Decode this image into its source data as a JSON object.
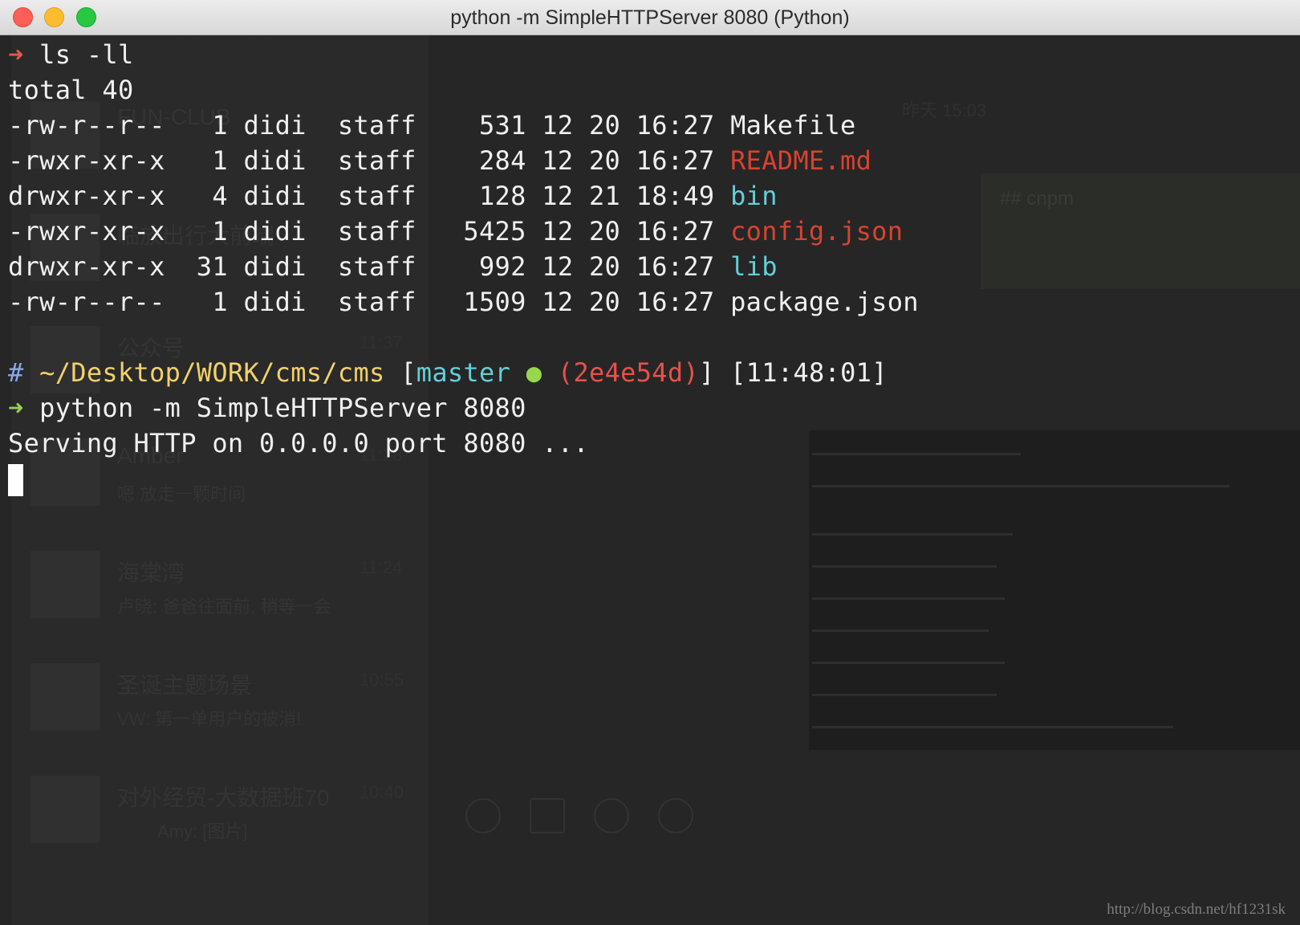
{
  "window": {
    "title": "python -m SimpleHTTPServer 8080 (Python)"
  },
  "terminal": {
    "prompt_arrow": "➜",
    "cmd1": "ls -ll",
    "total": "total 40",
    "files": [
      {
        "perms": "-rw-r--r--",
        "links": "1",
        "owner": "didi",
        "group": "staff",
        "size": "531",
        "month": "12",
        "day": "20",
        "time": "16:27",
        "name": "Makefile",
        "kind": "plain"
      },
      {
        "perms": "-rwxr-xr-x",
        "links": "1",
        "owner": "didi",
        "group": "staff",
        "size": "284",
        "month": "12",
        "day": "20",
        "time": "16:27",
        "name": "README.md",
        "kind": "exec"
      },
      {
        "perms": "drwxr-xr-x",
        "links": "4",
        "owner": "didi",
        "group": "staff",
        "size": "128",
        "month": "12",
        "day": "21",
        "time": "18:49",
        "name": "bin",
        "kind": "dir"
      },
      {
        "perms": "-rwxr-xr-x",
        "links": "1",
        "owner": "didi",
        "group": "staff",
        "size": "5425",
        "month": "12",
        "day": "20",
        "time": "16:27",
        "name": "config.json",
        "kind": "exec"
      },
      {
        "perms": "drwxr-xr-x",
        "links": "31",
        "owner": "didi",
        "group": "staff",
        "size": "992",
        "month": "12",
        "day": "20",
        "time": "16:27",
        "name": "lib",
        "kind": "dir"
      },
      {
        "perms": "-rw-r--r--",
        "links": "1",
        "owner": "didi",
        "group": "staff",
        "size": "1509",
        "month": "12",
        "day": "20",
        "time": "16:27",
        "name": "package.json",
        "kind": "plain"
      }
    ],
    "prompt": {
      "hash": "#",
      "path": "~/Desktop/WORK/cms/cms",
      "branch_open": "[",
      "branch": "master",
      "dot": "●",
      "commit": "(2e4e54d)",
      "branch_close": "]",
      "clock": "[11:48:01]"
    },
    "cmd2": "python -m SimpleHTTPServer 8080",
    "output": "Serving HTTP on 0.0.0.0 port 8080 ..."
  },
  "background": {
    "chats": [
      {
        "name": "FUN-CLUB",
        "time": "昨天 15:03"
      },
      {
        "name": "临放出行大前端",
        "time": ""
      },
      {
        "name": "公众号",
        "time": "11:37"
      },
      {
        "name": "Amber",
        "time": "11:28",
        "preview": "嗯 放走一颗时间"
      },
      {
        "name": "海棠湾",
        "time": "11:24",
        "preview": "卢晓: 爸爸往面前, 稍等一会"
      },
      {
        "name": "圣诞主题场景",
        "time": "10:55",
        "preview": "VW: 第一单用户的被消!"
      },
      {
        "name": "对外经贸-大数据班70",
        "time": "10:40",
        "preview": "Amy: [图片]"
      }
    ],
    "note_title": "## cnpm"
  },
  "watermark": "http://blog.csdn.net/hf1231sk"
}
